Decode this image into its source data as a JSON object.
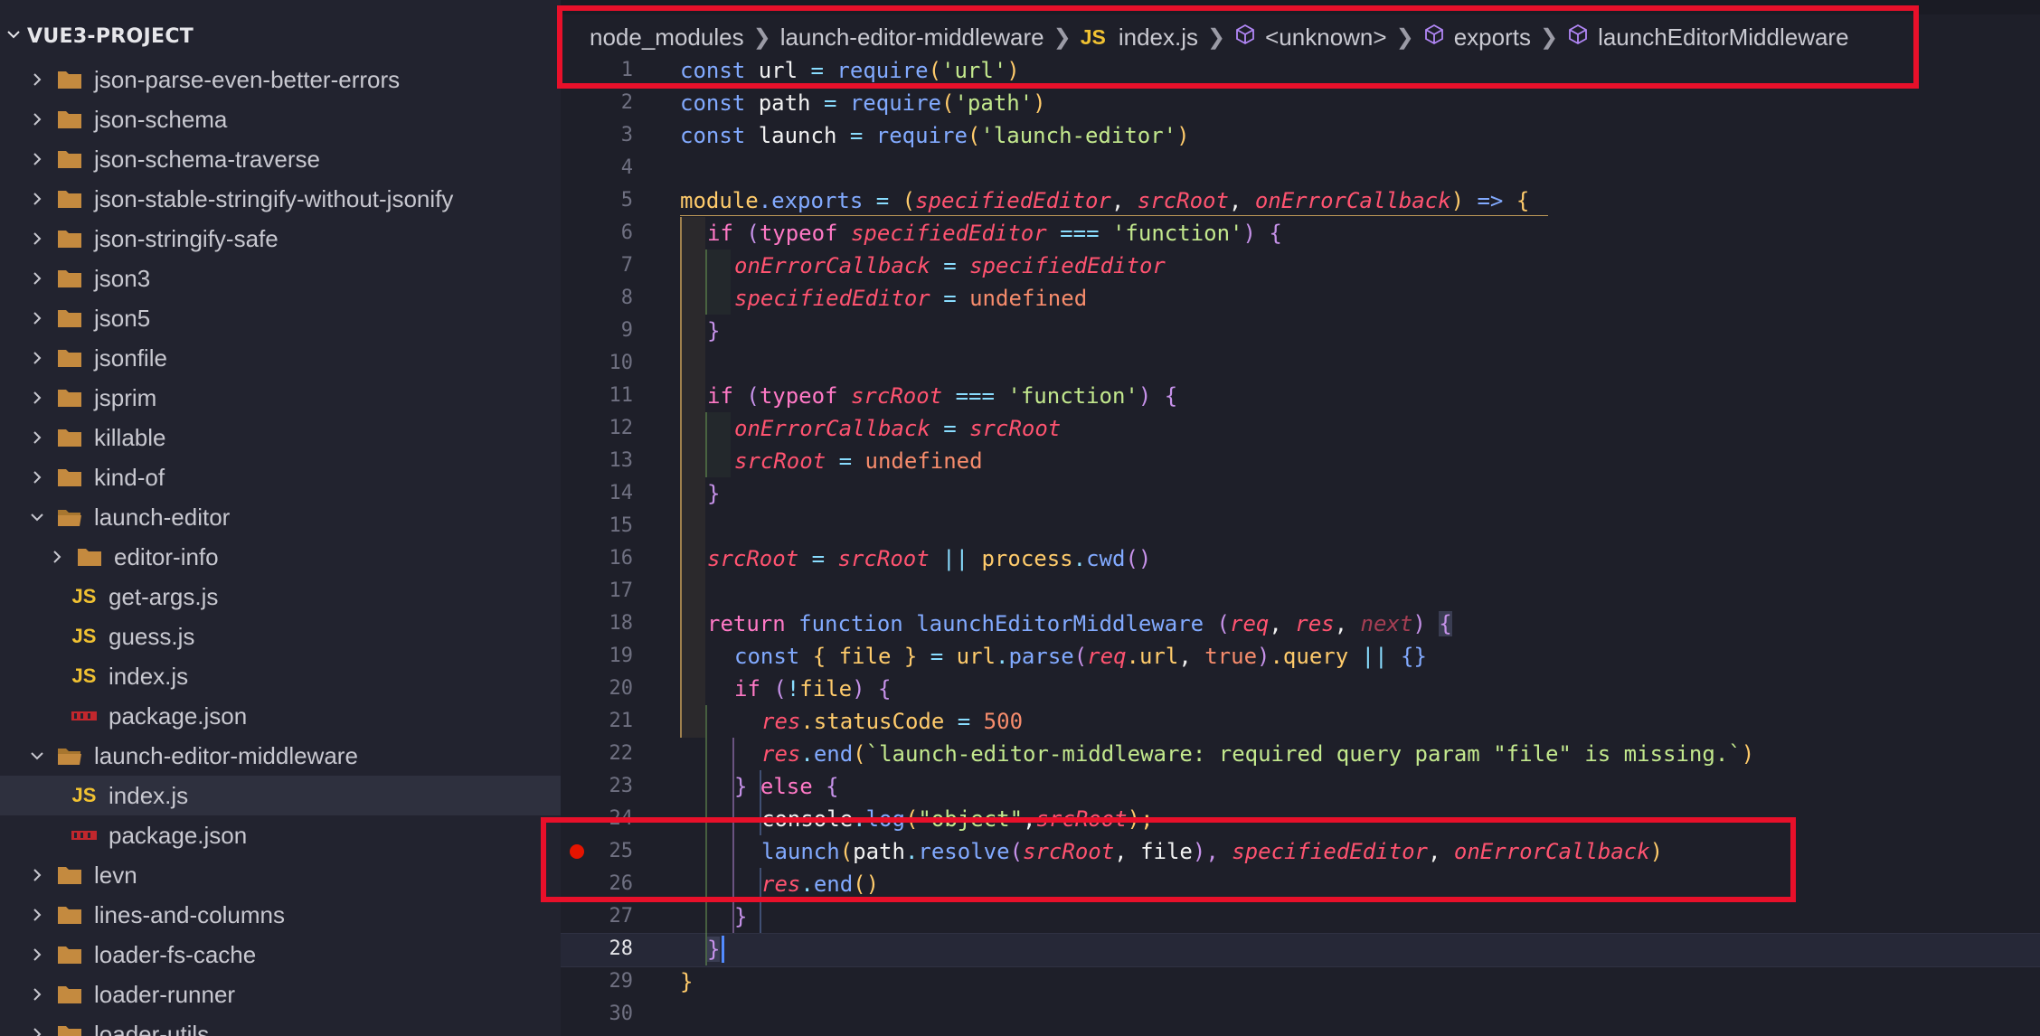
{
  "sidebar": {
    "project": "VUE3-PROJECT",
    "items": [
      {
        "label": "json-parse-even-better-errors",
        "kind": "folder",
        "expanded": false,
        "depth": 0
      },
      {
        "label": "json-schema",
        "kind": "folder",
        "expanded": false,
        "depth": 0
      },
      {
        "label": "json-schema-traverse",
        "kind": "folder",
        "expanded": false,
        "depth": 0
      },
      {
        "label": "json-stable-stringify-without-jsonify",
        "kind": "folder",
        "expanded": false,
        "depth": 0
      },
      {
        "label": "json-stringify-safe",
        "kind": "folder",
        "expanded": false,
        "depth": 0
      },
      {
        "label": "json3",
        "kind": "folder",
        "expanded": false,
        "depth": 0
      },
      {
        "label": "json5",
        "kind": "folder",
        "expanded": false,
        "depth": 0
      },
      {
        "label": "jsonfile",
        "kind": "folder",
        "expanded": false,
        "depth": 0
      },
      {
        "label": "jsprim",
        "kind": "folder",
        "expanded": false,
        "depth": 0
      },
      {
        "label": "killable",
        "kind": "folder",
        "expanded": false,
        "depth": 0
      },
      {
        "label": "kind-of",
        "kind": "folder",
        "expanded": false,
        "depth": 0
      },
      {
        "label": "launch-editor",
        "kind": "folder",
        "expanded": true,
        "depth": 0
      },
      {
        "label": "editor-info",
        "kind": "folder",
        "expanded": false,
        "depth": 1
      },
      {
        "label": "get-args.js",
        "kind": "js",
        "depth": 1
      },
      {
        "label": "guess.js",
        "kind": "js",
        "depth": 1
      },
      {
        "label": "index.js",
        "kind": "js",
        "depth": 1
      },
      {
        "label": "package.json",
        "kind": "npm",
        "depth": 1
      },
      {
        "label": "launch-editor-middleware",
        "kind": "folder",
        "expanded": true,
        "depth": 0
      },
      {
        "label": "index.js",
        "kind": "js",
        "depth": 1,
        "selected": true
      },
      {
        "label": "package.json",
        "kind": "npm",
        "depth": 1
      },
      {
        "label": "levn",
        "kind": "folder",
        "expanded": false,
        "depth": 0
      },
      {
        "label": "lines-and-columns",
        "kind": "folder",
        "expanded": false,
        "depth": 0
      },
      {
        "label": "loader-fs-cache",
        "kind": "folder",
        "expanded": false,
        "depth": 0
      },
      {
        "label": "loader-runner",
        "kind": "folder",
        "expanded": false,
        "depth": 0
      },
      {
        "label": "loader-utils",
        "kind": "folder",
        "expanded": false,
        "depth": 0
      }
    ],
    "js_badge": "JS"
  },
  "breadcrumb": {
    "parts": [
      "node_modules",
      "launch-editor-middleware",
      "index.js",
      "<unknown>",
      "exports",
      "launchEditorMiddleware"
    ],
    "js_badge": "JS"
  },
  "editor": {
    "line_numbers": [
      "1",
      "2",
      "3",
      "4",
      "5",
      "6",
      "7",
      "8",
      "9",
      "10",
      "11",
      "12",
      "13",
      "14",
      "15",
      "16",
      "17",
      "18",
      "19",
      "20",
      "21",
      "22",
      "23",
      "24",
      "25",
      "26",
      "27",
      "28",
      "29",
      "30"
    ],
    "active_line": "28",
    "breakpoint_line": "25",
    "code": {
      "l1": [
        "const",
        "url",
        "=",
        "require",
        "(",
        "'url'",
        ")"
      ],
      "l2": [
        "const",
        "path",
        "=",
        "require",
        "(",
        "'path'",
        ")"
      ],
      "l3": [
        "const",
        "launch",
        "=",
        "require",
        "(",
        "'launch-editor'",
        ")"
      ],
      "l5": [
        "module",
        ".exports",
        "=",
        "(",
        "specifiedEditor",
        ",",
        "srcRoot",
        ",",
        "onErrorCallback",
        ")",
        "=>",
        "{"
      ],
      "l6": [
        "if",
        "(",
        "typeof",
        "specifiedEditor",
        "===",
        "'function'",
        ")",
        "{"
      ],
      "l7": [
        "onErrorCallback",
        "=",
        "specifiedEditor"
      ],
      "l8": [
        "specifiedEditor",
        "=",
        "undefined"
      ],
      "l9": [
        "}"
      ],
      "l11": [
        "if",
        "(",
        "typeof",
        "srcRoot",
        "===",
        "'function'",
        ")",
        "{"
      ],
      "l12": [
        "onErrorCallback",
        "=",
        "srcRoot"
      ],
      "l13": [
        "srcRoot",
        "=",
        "undefined"
      ],
      "l14": [
        "}"
      ],
      "l16": [
        "srcRoot",
        "=",
        "srcRoot",
        "||",
        "process",
        ".",
        "cwd",
        "()"
      ],
      "l18": [
        "return",
        "function",
        "launchEditorMiddleware",
        "(",
        "req",
        ",",
        "res",
        ",",
        "next",
        ")",
        "{"
      ],
      "l19": [
        "const",
        "{ file }",
        "=",
        "url",
        ".",
        "parse",
        "(",
        "req",
        ".url",
        ",",
        "true",
        ")",
        ".query",
        "||",
        "{}"
      ],
      "l20": [
        "if",
        "(",
        "!",
        "file",
        ")",
        "{"
      ],
      "l21": [
        "res",
        ".statusCode",
        "=",
        "500"
      ],
      "l22": [
        "res",
        ".",
        "end",
        "(",
        "`launch-editor-middleware: required query param \"file\" is missing.`",
        ")"
      ],
      "l23": [
        "}",
        "else",
        "{"
      ],
      "l24": [
        "console",
        ".",
        "log",
        "(",
        "\"object\"",
        ",",
        "srcRoot",
        ");"
      ],
      "l25": [
        "launch",
        "(",
        "path",
        ".",
        "resolve",
        "(",
        "srcRoot",
        ",",
        "file",
        "),",
        "specifiedEditor",
        ",",
        "onErrorCallback",
        ")"
      ],
      "l26": [
        "res",
        ".",
        "end",
        "()"
      ],
      "l27": [
        "}"
      ],
      "l28": [
        "}"
      ],
      "l29": [
        "}"
      ]
    }
  },
  "colors": {
    "annotation_box": "#e8102a",
    "breakpoint": "#e51400",
    "js_badge": "#f1c232",
    "folder": "#c48a3f"
  }
}
